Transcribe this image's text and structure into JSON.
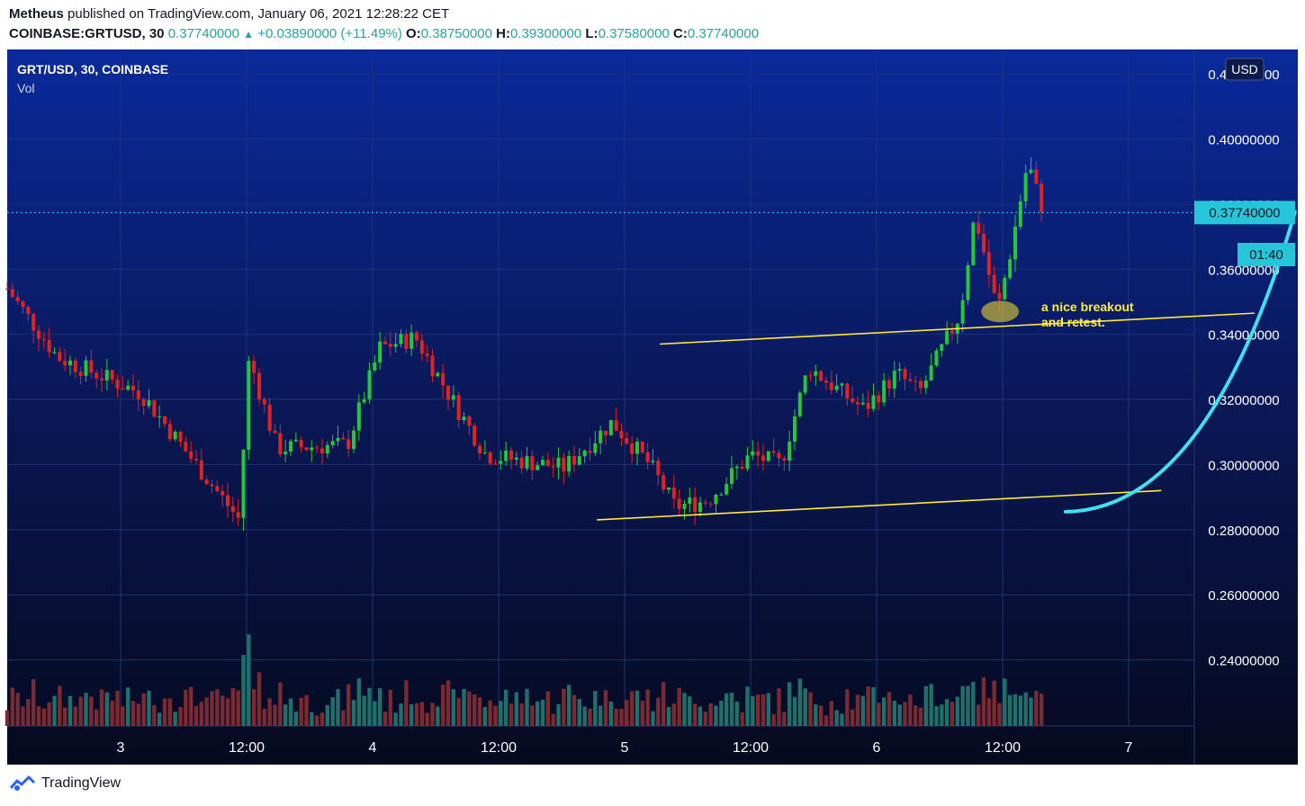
{
  "header": {
    "author": "Metheus",
    "published_text": " published on TradingView.com, January 06, 2021 12:28:22 CET",
    "symbol": "COINBASE:GRTUSD, 30",
    "last": "0.37740000",
    "change": "+0.03890000 (+11.49%)",
    "o_label": "O:",
    "o_value": "0.38750000",
    "h_label": "H:",
    "h_value": "0.39300000",
    "l_label": "L:",
    "l_value": "0.37580000",
    "c_label": "C:",
    "c_value": "0.37740000"
  },
  "pane": {
    "legend_symbol": "GRT/USD, 30, COINBASE",
    "legend_vol": "Vol",
    "currency_button": "USD",
    "price_badge": "0.37740000",
    "countdown_badge": "01:40"
  },
  "annotation": {
    "line1": "a nice breakout",
    "line2": "and retest."
  },
  "footer": {
    "brand": "TradingView"
  },
  "colors": {
    "up": "#26c63a",
    "down": "#e02222",
    "channel": "#ffeb3b",
    "curve": "#40e0f0",
    "price_line": "#26c6da",
    "annotation": "#ffeb3b"
  },
  "chart_data": {
    "type": "candlestick",
    "y_ticks": [
      "0.42000000",
      "0.40000000",
      "0.38000000",
      "0.36000000",
      "0.34000000",
      "0.32000000",
      "0.30000000",
      "0.28000000",
      "0.26000000",
      "0.24000000"
    ],
    "x_ticks": [
      "3",
      "12:00",
      "4",
      "12:00",
      "5",
      "12:00",
      "6",
      "12:00",
      "7"
    ],
    "ylim": [
      0.2197,
      0.4275
    ],
    "last_price": 0.3774,
    "key_points": {
      "start_close": 0.354,
      "low_jan3": 0.283,
      "spike_jan4": 0.345,
      "low_jan5": 0.287,
      "high_jan6": 0.4,
      "retest": 0.347,
      "close": 0.3774
    },
    "channel_upper": {
      "from": {
        "t": 2.14,
        "p": 0.337
      },
      "to": {
        "t": 4.5,
        "p": 0.3465
      }
    },
    "channel_lower": {
      "from": {
        "t": 1.89,
        "p": 0.283
      },
      "to": {
        "t": 4.13,
        "p": 0.292
      }
    },
    "parabolic_support": {
      "from": {
        "t": 3.75,
        "p": 0.2855
      },
      "to": {
        "t": 4.66,
        "p": 0.3775
      }
    }
  }
}
